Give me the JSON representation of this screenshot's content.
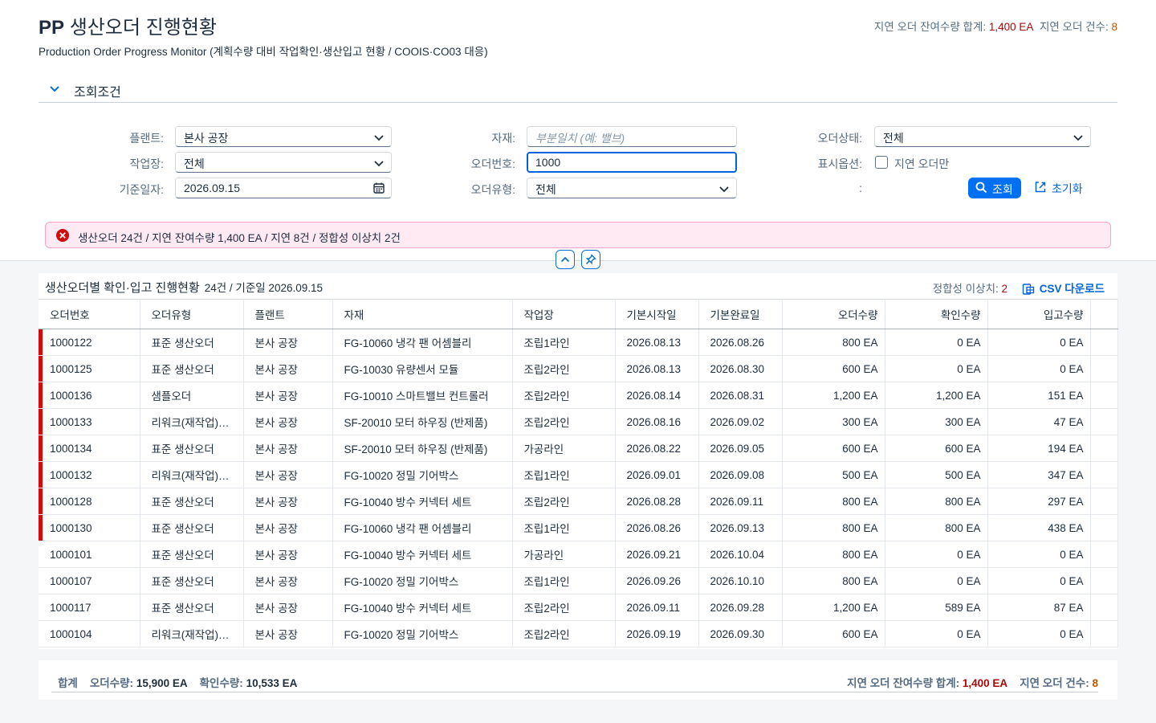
{
  "header": {
    "title_bold": "PP",
    "title_rest": "생산오더 진행현황",
    "subtitle": "Production Order Progress Monitor (계획수량 대비 작업확인·생산입고 현황 / COOIS·CO03 대응)",
    "kpi_remaining_label": "지연 오더 잔여수량 합계:",
    "kpi_remaining_value": "1,400 EA",
    "kpi_count_label": "지연 오더 건수:",
    "kpi_count_value": "8"
  },
  "filter": {
    "section_label": "조회조건",
    "plant_label": "플랜트:",
    "plant_value": "본사 공장",
    "workcenter_label": "작업장:",
    "workcenter_value": "전체",
    "date_label": "기준일자:",
    "date_value": "2026.09.15",
    "material_label": "자재:",
    "material_placeholder": "부분일치 (예: 밸브)",
    "order_no_label": "오더번호:",
    "order_no_value": "1000",
    "order_type_label": "오더유형:",
    "order_type_value": "전체",
    "status_label": "오더상태:",
    "status_value": "전체",
    "display_label": "표시옵션:",
    "late_only_label": "지연 오더만",
    "blank_label": ":",
    "search_label": "조회",
    "reset_label": "초기화"
  },
  "message": {
    "text": "생산오더 24건 / 지연 잔여수량 1,400 EA / 지연 8건 / 정합성 이상치 2건"
  },
  "table": {
    "title": "생산오더별 확인·입고 진행현황",
    "subtitle": "24건 / 기준일 2026.09.15",
    "anomaly_label": "정합성 이상치:",
    "anomaly_value": "2",
    "csv_label": "CSV 다운로드",
    "columns": [
      "오더번호",
      "오더유형",
      "플랜트",
      "자재",
      "작업장",
      "기본시작일",
      "기본완료일",
      "오더수량",
      "확인수량",
      "입고수량"
    ],
    "rows": [
      {
        "late": true,
        "cells": [
          "1000122",
          "표준 생산오더",
          "본사 공장",
          "FG-10060 냉각 팬 어셈블리",
          "조립1라인",
          "2026.08.13",
          "2026.08.26",
          "800 EA",
          "0 EA",
          "0 EA"
        ]
      },
      {
        "late": true,
        "cells": [
          "1000125",
          "표준 생산오더",
          "본사 공장",
          "FG-10030 유량센서 모듈",
          "조립2라인",
          "2026.08.13",
          "2026.08.30",
          "600 EA",
          "0 EA",
          "0 EA"
        ]
      },
      {
        "late": true,
        "cells": [
          "1000136",
          "샘플오더",
          "본사 공장",
          "FG-10010 스마트밸브 컨트롤러",
          "조립2라인",
          "2026.08.14",
          "2026.08.31",
          "1,200 EA",
          "1,200 EA",
          "151 EA"
        ]
      },
      {
        "late": true,
        "cells": [
          "1000133",
          "리워크(재작업) 오더",
          "본사 공장",
          "SF-20010 모터 하우징 (반제품)",
          "조립2라인",
          "2026.08.16",
          "2026.09.02",
          "300 EA",
          "300 EA",
          "47 EA"
        ]
      },
      {
        "late": true,
        "cells": [
          "1000134",
          "표준 생산오더",
          "본사 공장",
          "SF-20010 모터 하우징 (반제품)",
          "가공라인",
          "2026.08.22",
          "2026.09.05",
          "600 EA",
          "600 EA",
          "194 EA"
        ]
      },
      {
        "late": true,
        "cells": [
          "1000132",
          "리워크(재작업) 오더",
          "본사 공장",
          "FG-10020 정밀 기어박스",
          "조립1라인",
          "2026.09.01",
          "2026.09.08",
          "500 EA",
          "500 EA",
          "347 EA"
        ]
      },
      {
        "late": true,
        "cells": [
          "1000128",
          "표준 생산오더",
          "본사 공장",
          "FG-10040 방수 커넥터 세트",
          "조립2라인",
          "2026.08.28",
          "2026.09.11",
          "800 EA",
          "800 EA",
          "297 EA"
        ]
      },
      {
        "late": true,
        "cells": [
          "1000130",
          "표준 생산오더",
          "본사 공장",
          "FG-10060 냉각 팬 어셈블리",
          "조립1라인",
          "2026.08.26",
          "2026.09.13",
          "800 EA",
          "800 EA",
          "438 EA"
        ]
      },
      {
        "late": false,
        "cells": [
          "1000101",
          "표준 생산오더",
          "본사 공장",
          "FG-10040 방수 커넥터 세트",
          "가공라인",
          "2026.09.21",
          "2026.10.04",
          "800 EA",
          "0 EA",
          "0 EA"
        ]
      },
      {
        "late": false,
        "cells": [
          "1000107",
          "표준 생산오더",
          "본사 공장",
          "FG-10020 정밀 기어박스",
          "조립1라인",
          "2026.09.26",
          "2026.10.10",
          "800 EA",
          "0 EA",
          "0 EA"
        ]
      },
      {
        "late": false,
        "cells": [
          "1000117",
          "표준 생산오더",
          "본사 공장",
          "FG-10040 방수 커넥터 세트",
          "조립2라인",
          "2026.09.11",
          "2026.09.28",
          "1,200 EA",
          "589 EA",
          "87 EA"
        ]
      },
      {
        "late": false,
        "cells": [
          "1000104",
          "리워크(재작업) 오더",
          "본사 공장",
          "FG-10020 정밀 기어박스",
          "조립2라인",
          "2026.09.19",
          "2026.09.30",
          "600 EA",
          "0 EA",
          "0 EA"
        ]
      }
    ]
  },
  "totals": {
    "label": "합계",
    "order_qty_label": "오더수량:",
    "order_qty_value": "15,900 EA",
    "confirm_qty_label": "확인수량:",
    "confirm_qty_value": "10,533 EA",
    "remaining_label": "지연 오더 잔여수량 합계:",
    "remaining_value": "1,400 EA",
    "count_label": "지연 오더 건수:",
    "count_value": "8"
  },
  "colors": {
    "accent": "#0070f2",
    "late_bar": "#d20a0a",
    "error_bg": "#ffeaf4"
  }
}
